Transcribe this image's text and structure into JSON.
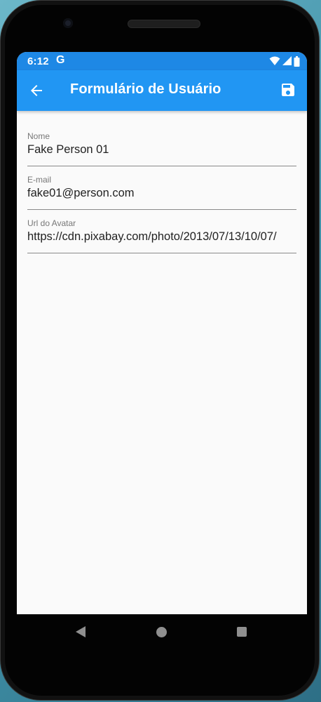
{
  "status_bar": {
    "time": "6:12",
    "notification_glyph": "G",
    "icons": [
      "wifi-icon",
      "signal-icon",
      "battery-icon"
    ]
  },
  "app_bar": {
    "title": "Formulário de Usuário",
    "leading_icon": "arrow-back-icon",
    "action_icon": "save-icon",
    "color": "#2196f3",
    "status_color": "#1e88e5"
  },
  "form": {
    "fields": [
      {
        "label": "Nome",
        "value": "Fake Person 01"
      },
      {
        "label": "E-mail",
        "value": "fake01@person.com"
      },
      {
        "label": "Url do Avatar",
        "value": "https://cdn.pixabay.com/photo/2013/07/13/10/07/"
      }
    ]
  },
  "nav_bar": {
    "buttons": [
      "nav-back-icon",
      "nav-home-icon",
      "nav-recents-icon"
    ]
  }
}
